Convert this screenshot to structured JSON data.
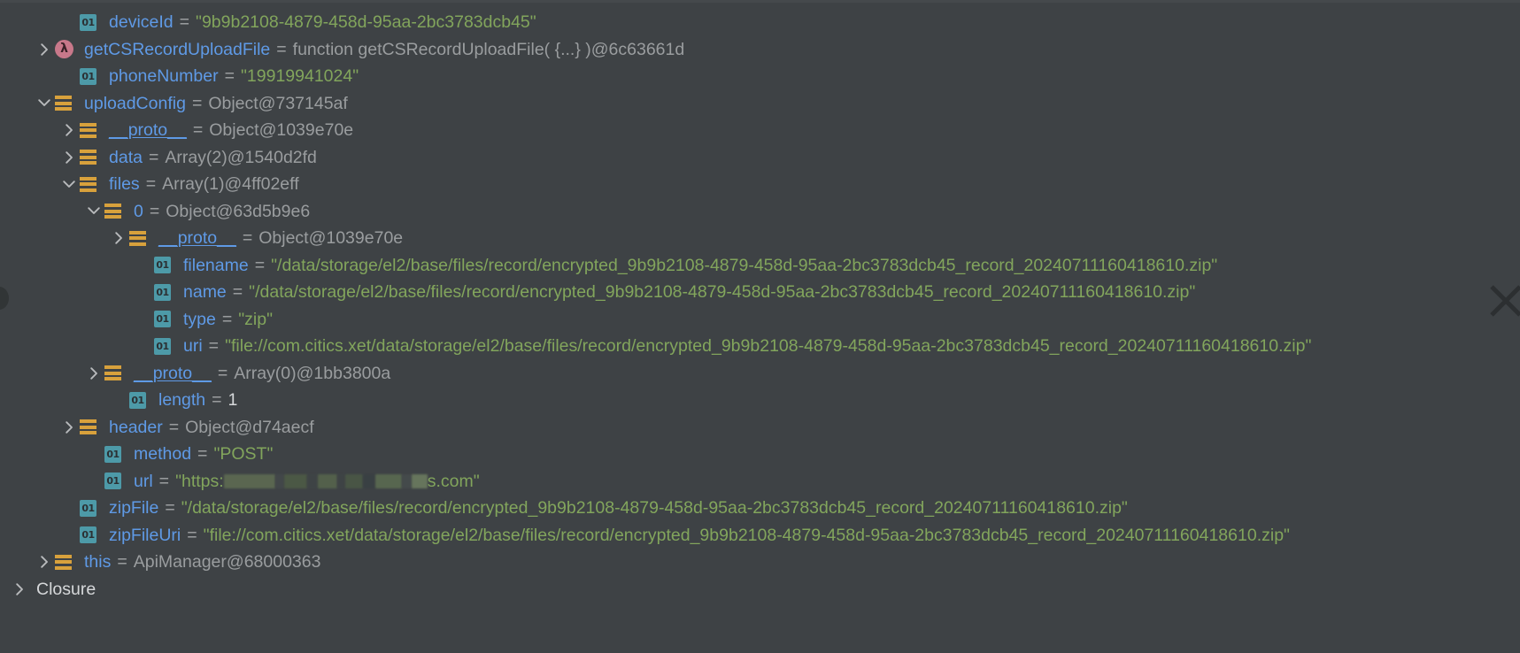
{
  "panel": {
    "title": "Debugger Variables",
    "background_color": "#3e4245",
    "name_color": "#5f9ae6",
    "string_color": "#82a55c",
    "reference_color": "#9a9d9f",
    "object_icon_color": "#d8a13c",
    "primitive_icon_color": "#4d9aa8",
    "function_icon_color": "#c8788a"
  },
  "rows": [
    {
      "indent": 2,
      "twisty": "none",
      "icon": "primitive-01-icon",
      "name": "deviceId",
      "eq": "=",
      "value": "\"9b9b2108-4879-458d-95aa-2bc3783dcb45\"",
      "value_kind": "string"
    },
    {
      "indent": 1,
      "twisty": "collapsed",
      "icon": "lambda-function-icon",
      "name": "getCSRecordUploadFile",
      "eq": "=",
      "value": "function getCSRecordUploadFile( {...} )@6c63661d",
      "value_kind": "ref"
    },
    {
      "indent": 2,
      "twisty": "none",
      "icon": "primitive-01-icon",
      "name": "phoneNumber",
      "eq": "=",
      "value": "\"19919941024\"",
      "value_kind": "string"
    },
    {
      "indent": 1,
      "twisty": "expanded",
      "icon": "object-icon",
      "name": "uploadConfig",
      "eq": "=",
      "value": "Object@737145af",
      "value_kind": "ref"
    },
    {
      "indent": 2,
      "twisty": "collapsed",
      "icon": "object-icon",
      "name": "__proto__",
      "underline": true,
      "eq": "=",
      "value": "Object@1039e70e",
      "value_kind": "ref"
    },
    {
      "indent": 2,
      "twisty": "collapsed",
      "icon": "object-icon",
      "name": "data",
      "eq": "=",
      "value": "Array(2)@1540d2fd",
      "value_kind": "ref"
    },
    {
      "indent": 2,
      "twisty": "expanded",
      "icon": "object-icon",
      "name": "files",
      "eq": "=",
      "value": "Array(1)@4ff02eff",
      "value_kind": "ref"
    },
    {
      "indent": 3,
      "twisty": "expanded",
      "icon": "object-icon",
      "name": "0",
      "eq": "=",
      "value": "Object@63d5b9e6",
      "value_kind": "ref"
    },
    {
      "indent": 4,
      "twisty": "collapsed",
      "icon": "object-icon",
      "name": "__proto__",
      "underline": true,
      "eq": "=",
      "value": "Object@1039e70e",
      "value_kind": "ref"
    },
    {
      "indent": 5,
      "twisty": "none",
      "icon": "primitive-01-icon",
      "name": "filename",
      "eq": "=",
      "value": "\"/data/storage/el2/base/files/record/encrypted_9b9b2108-4879-458d-95aa-2bc3783dcb45_record_20240711160418610.zip\"",
      "value_kind": "string"
    },
    {
      "indent": 5,
      "twisty": "none",
      "icon": "primitive-01-icon",
      "name": "name",
      "eq": "=",
      "value": "\"/data/storage/el2/base/files/record/encrypted_9b9b2108-4879-458d-95aa-2bc3783dcb45_record_20240711160418610.zip\"",
      "value_kind": "string"
    },
    {
      "indent": 5,
      "twisty": "none",
      "icon": "primitive-01-icon",
      "name": "type",
      "eq": "=",
      "value": "\"zip\"",
      "value_kind": "string"
    },
    {
      "indent": 5,
      "twisty": "none",
      "icon": "primitive-01-icon",
      "name": "uri",
      "eq": "=",
      "value": "\"file://com.citics.xet/data/storage/el2/base/files/record/encrypted_9b9b2108-4879-458d-95aa-2bc3783dcb45_record_20240711160418610.zip\"",
      "value_kind": "string"
    },
    {
      "indent": 3,
      "twisty": "collapsed",
      "icon": "object-icon",
      "name": "__proto__",
      "underline": true,
      "eq": "=",
      "value": "Array(0)@1bb3800a",
      "value_kind": "ref"
    },
    {
      "indent": 4,
      "twisty": "none",
      "icon": "primitive-01-icon",
      "name": "length",
      "eq": "=",
      "value": "1",
      "value_kind": "num"
    },
    {
      "indent": 2,
      "twisty": "collapsed",
      "icon": "object-icon",
      "name": "header",
      "eq": "=",
      "value": "Object@d74aecf",
      "value_kind": "ref"
    },
    {
      "indent": 3,
      "twisty": "none",
      "icon": "primitive-01-icon",
      "name": "method",
      "eq": "=",
      "value": "\"POST\"",
      "value_kind": "string"
    },
    {
      "indent": 3,
      "twisty": "none",
      "icon": "primitive-01-icon",
      "name": "url",
      "eq": "=",
      "value": "\"https:",
      "value_kind": "string",
      "redacted": true,
      "value_suffix": "s.com\""
    },
    {
      "indent": 2,
      "twisty": "none",
      "icon": "primitive-01-icon",
      "name": "zipFile",
      "eq": "=",
      "value": "\"/data/storage/el2/base/files/record/encrypted_9b9b2108-4879-458d-95aa-2bc3783dcb45_record_20240711160418610.zip\"",
      "value_kind": "string"
    },
    {
      "indent": 2,
      "twisty": "none",
      "icon": "primitive-01-icon",
      "name": "zipFileUri",
      "eq": "=",
      "value": "\"file://com.citics.xet/data/storage/el2/base/files/record/encrypted_9b9b2108-4879-458d-95aa-2bc3783dcb45_record_20240711160418610.zip\"",
      "value_kind": "string"
    },
    {
      "indent": 1,
      "twisty": "collapsed",
      "icon": "object-icon",
      "name": "this",
      "eq": "=",
      "value": "ApiManager@68000363",
      "value_kind": "ref"
    },
    {
      "indent": 0,
      "twisty": "collapsed",
      "icon": "none",
      "name": "Closure",
      "eq": "",
      "value": "",
      "value_kind": "plain"
    }
  ],
  "icons": {
    "primitive_badge_text": "01",
    "lambda_glyph": "λ"
  }
}
